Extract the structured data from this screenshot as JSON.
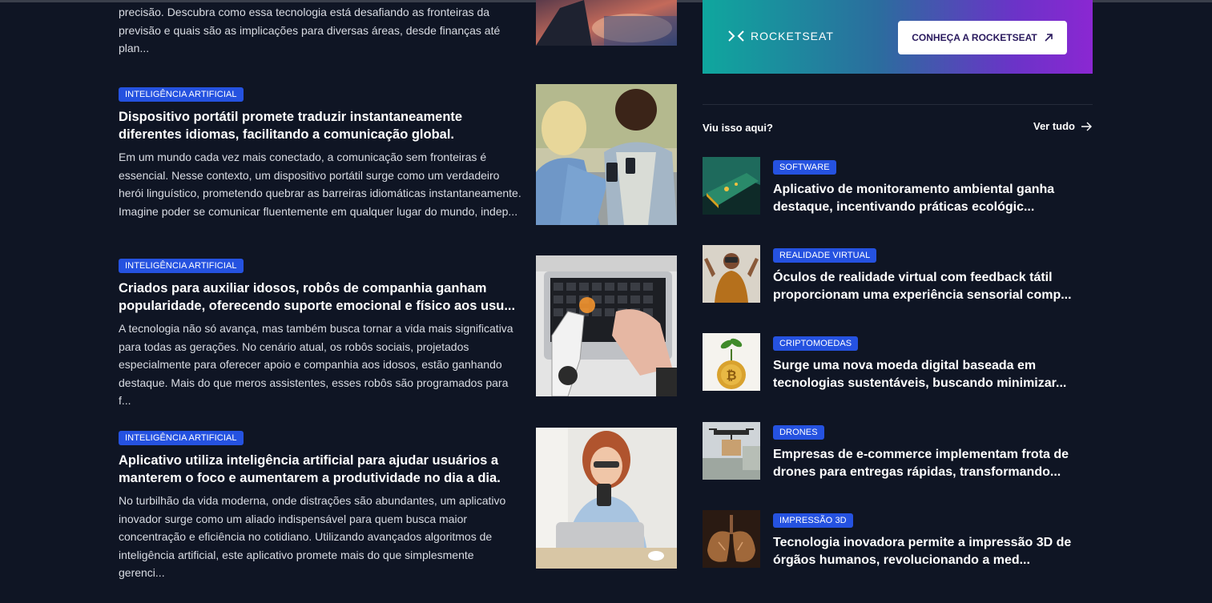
{
  "partial_article": {
    "excerpt_lines": [
      "precisão. Descubra como essa tecnologia está desafiando as fronteiras da",
      "previsão e quais são as implicações para diversas áreas, desde finanças até",
      "plan..."
    ]
  },
  "articles": [
    {
      "tag": "INTELIGÊNCIA ARTIFICIAL",
      "title_lines": [
        "Dispositivo portátil promete traduzir instantaneamente",
        "diferentes idiomas, facilitando a comunicação global."
      ],
      "excerpt_lines": [
        "Em um mundo cada vez mais conectado, a comunicação sem fronteiras é",
        "essencial. Nesse contexto, um dispositivo portátil surge como um verdadeiro",
        "herói linguístico, prometendo quebrar as barreiras idiomáticas instantaneamente.",
        "Imagine poder se comunicar fluentemente em qualquer lugar do mundo, indep..."
      ]
    },
    {
      "tag": "INTELIGÊNCIA ARTIFICIAL",
      "title_lines": [
        "Criados para auxiliar idosos, robôs de companhia ganham",
        "popularidade, oferecendo suporte emocional e físico aos usu..."
      ],
      "excerpt_lines": [
        "A tecnologia não só avança, mas também busca tornar a vida mais significativa",
        "para todas as gerações. No cenário atual, os robôs sociais, projetados",
        "especialmente para oferecer apoio e companhia aos idosos, estão ganhando",
        "destaque. Mais do que meros assistentes, esses robôs são programados para f..."
      ]
    },
    {
      "tag": "INTELIGÊNCIA ARTIFICIAL",
      "title_lines": [
        "Aplicativo utiliza inteligência artificial para ajudar usuários a",
        "manterem o foco e aumentarem a produtividade no dia a dia."
      ],
      "excerpt_lines": [
        "No turbilhão da vida moderna, onde distrações são abundantes, um aplicativo",
        "inovador surge como um aliado indispensável para quem busca maior",
        "concentração e eficiência no cotidiano. Utilizando avançados algoritmos de",
        "inteligência artificial, este aplicativo promete mais do que simplesmente gerenci..."
      ]
    }
  ],
  "banner": {
    "logo_text": "ROCKETSEAT",
    "cta_label": "CONHEÇA A ROCKETSEAT"
  },
  "sidebar": {
    "heading": "Viu isso aqui?",
    "see_all": "Ver tudo",
    "items": [
      {
        "tag": "SOFTWARE",
        "title_lines": [
          "Aplicativo de monitoramento ambiental ganha",
          "destaque, incentivando práticas ecológic..."
        ]
      },
      {
        "tag": "REALIDADE VIRTUAL",
        "title_lines": [
          "Óculos de realidade virtual com feedback tátil",
          "proporcionam uma experiência sensorial comp..."
        ]
      },
      {
        "tag": "CRIPTOMOEDAS",
        "title_lines": [
          "Surge uma nova moeda digital baseada em",
          "tecnologias sustentáveis, buscando minimizar..."
        ]
      },
      {
        "tag": "DRONES",
        "title_lines": [
          "Empresas de e-commerce implementam frota de",
          "drones para entregas rápidas, transformando..."
        ]
      },
      {
        "tag": "IMPRESSÃO 3D",
        "title_lines": [
          "Tecnologia inovadora permite a impressão 3D de",
          "órgãos humanos, revolucionando a med..."
        ]
      }
    ]
  },
  "colors": {
    "background": "#0f1524",
    "tag": "#2552e0",
    "banner_start": "#0fa79e",
    "banner_end": "#8b27d2"
  },
  "icons": [
    "rocketseat-logo-icon",
    "external-arrow-icon",
    "arrow-right-icon"
  ]
}
